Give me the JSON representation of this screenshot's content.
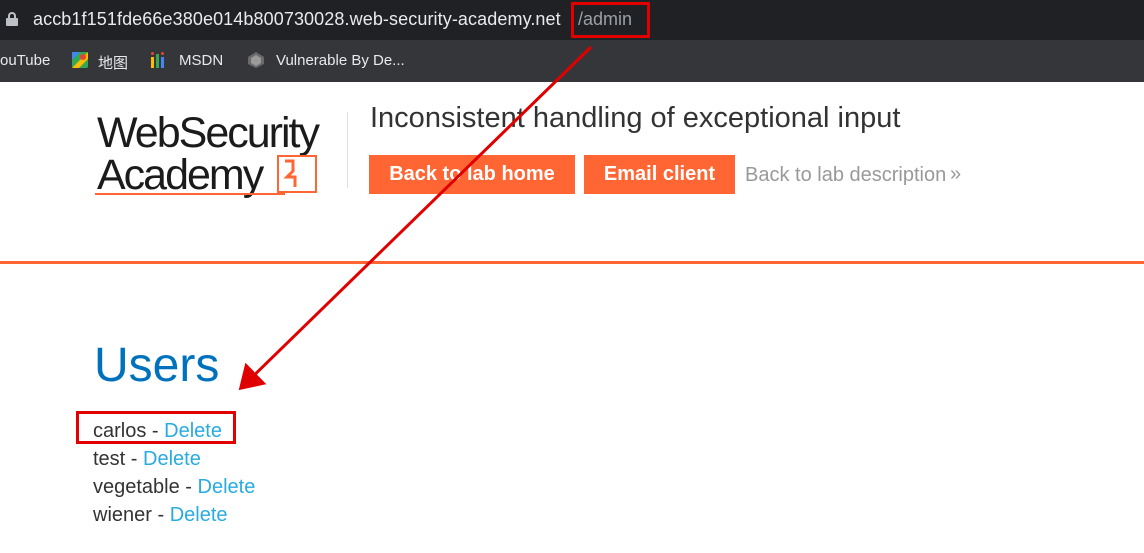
{
  "browser": {
    "url_host": "accb1f151fde66e380e014b800730028.web-security-academy.net",
    "url_path": "/admin",
    "bookmarks": [
      "ouTube",
      "地图",
      "MSDN",
      "Vulnerable By De..."
    ]
  },
  "header": {
    "logo_line1": "WebSecurity",
    "logo_line2": "Academy",
    "logo_icon": "lightning-bolt-icon",
    "lab_title": "Inconsistent handling of exceptional input",
    "back_home_label": "Back to lab home",
    "email_client_label": "Email client",
    "back_description_label": "Back to lab description",
    "back_description_icon": "»"
  },
  "main": {
    "heading": "Users",
    "users": [
      {
        "name": "carlos",
        "separator": " - ",
        "action": "Delete"
      },
      {
        "name": "test",
        "separator": " - ",
        "action": "Delete"
      },
      {
        "name": "vegetable",
        "separator": " - ",
        "action": "Delete"
      },
      {
        "name": "wiener",
        "separator": " - ",
        "action": "Delete"
      }
    ]
  },
  "colors": {
    "accent": "#ff6633",
    "heading": "#0071bc",
    "link": "#29abe2",
    "annotation": "#e00000"
  }
}
